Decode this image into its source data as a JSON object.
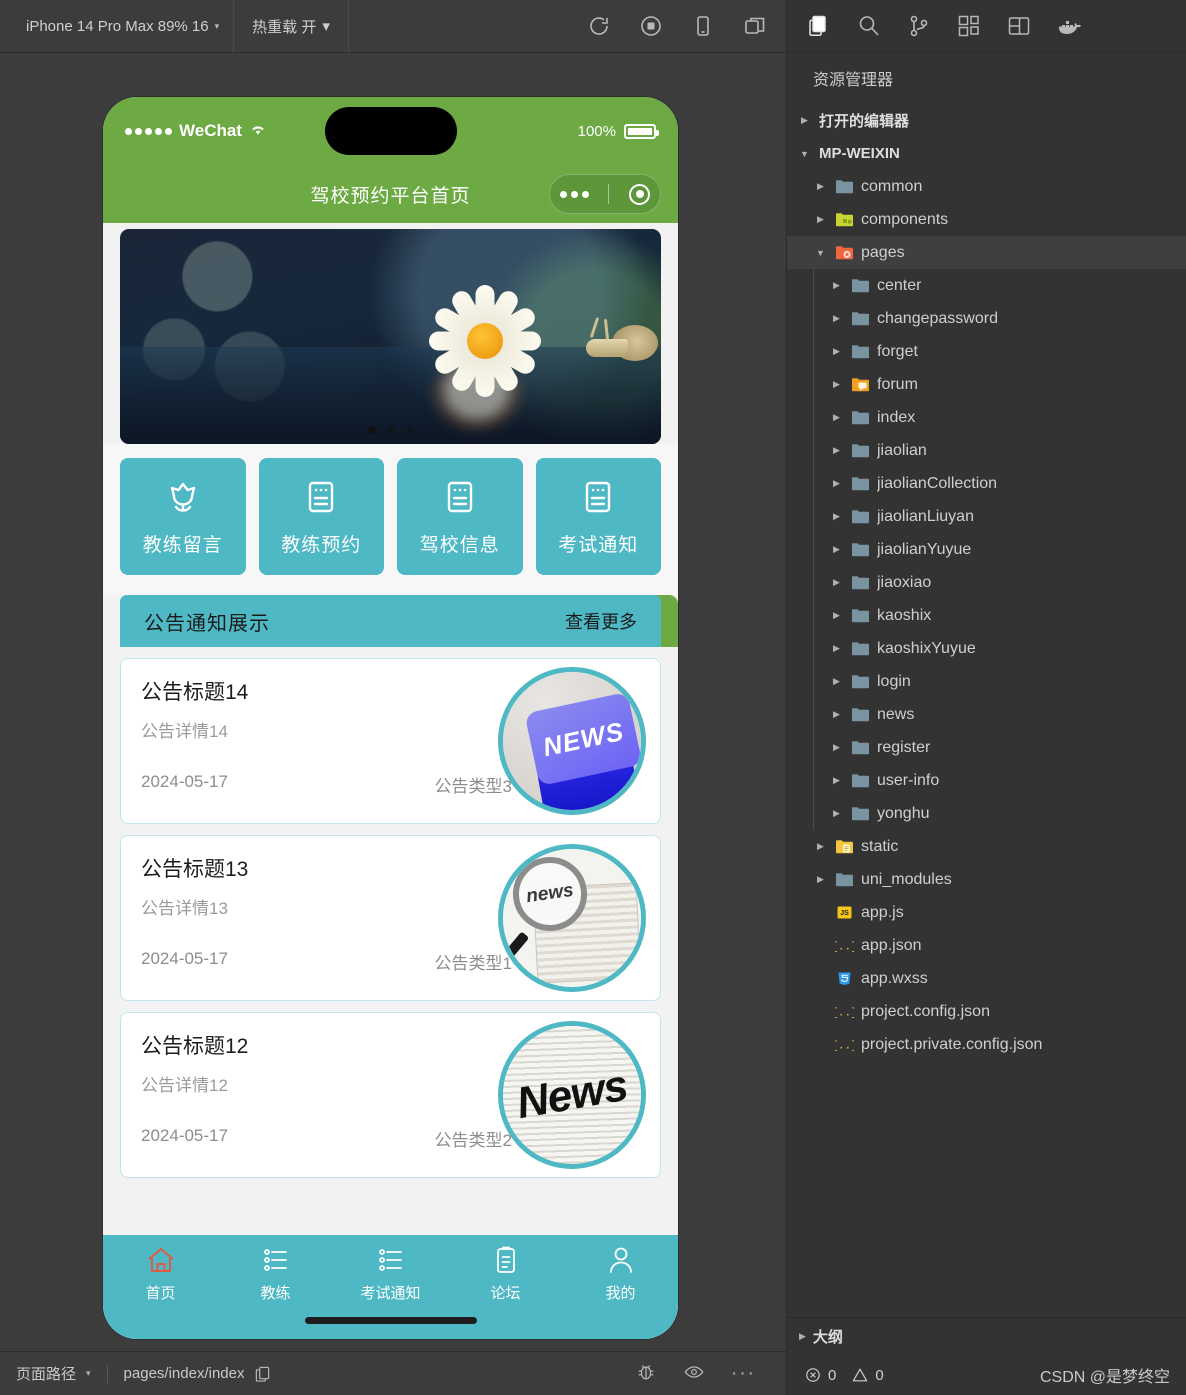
{
  "simulator": {
    "toolbar": {
      "device_label": "iPhone 14 Pro Max 89% 16",
      "hotreload_label": "热重载 开",
      "caret": "▾",
      "icons": [
        "refresh-icon",
        "stop-record-icon",
        "device-icon",
        "multi-window-icon"
      ]
    },
    "phone": {
      "status_bar": {
        "carrier": "WeChat",
        "battery_percent": "100%"
      },
      "nav_title": "驾校预约平台首页",
      "banner": {
        "dot_count": 3,
        "active_dot": 0
      },
      "categories": [
        {
          "label": "教练留言",
          "icon": "flower-icon"
        },
        {
          "label": "教练预约",
          "icon": "document-icon"
        },
        {
          "label": "驾校信息",
          "icon": "document-icon"
        },
        {
          "label": "考试通知",
          "icon": "document-icon"
        }
      ],
      "announce": {
        "title": "公告通知展示",
        "more": "查看更多"
      },
      "news": [
        {
          "title": "公告标题14",
          "desc": "公告详情14",
          "date": "2024-05-17",
          "type": "公告类型3",
          "thumb": "news-tag-thumb",
          "thumb_text": "NEWS"
        },
        {
          "title": "公告标题13",
          "desc": "公告详情13",
          "date": "2024-05-17",
          "type": "公告类型1",
          "thumb": "news-magnifier-thumb",
          "thumb_text": "news"
        },
        {
          "title": "公告标题12",
          "desc": "公告详情12",
          "date": "2024-05-17",
          "type": "公告类型2",
          "thumb": "news-paper-thumb",
          "thumb_text": "News"
        }
      ],
      "tabs": [
        {
          "label": "首页",
          "icon": "home-icon",
          "active": true
        },
        {
          "label": "教练",
          "icon": "list-icon",
          "active": false
        },
        {
          "label": "考试通知",
          "icon": "list-icon",
          "active": false
        },
        {
          "label": "论坛",
          "icon": "clipboard-icon",
          "active": false
        },
        {
          "label": "我的",
          "icon": "person-icon",
          "active": false
        }
      ]
    },
    "status_bar": {
      "path_label": "页面路径",
      "caret": "▾",
      "path_value": "pages/index/index",
      "icons": [
        "copy-icon",
        "bug-icon",
        "eye-icon",
        "more-icon"
      ]
    }
  },
  "explorer": {
    "activity_icons": [
      "files-icon",
      "search-icon",
      "source-control-icon",
      "extensions-icon",
      "layout-icon",
      "docker-icon"
    ],
    "title": "资源管理器",
    "tree": [
      {
        "label": "打开的编辑器",
        "type": "section",
        "indent": 0,
        "arrow": "right",
        "icon": "none"
      },
      {
        "label": "MP-WEIXIN",
        "type": "section",
        "indent": 0,
        "arrow": "down",
        "icon": "none"
      },
      {
        "label": "common",
        "type": "folder",
        "indent": 1,
        "arrow": "right",
        "icon": "folder-blue"
      },
      {
        "label": "components",
        "type": "folder",
        "indent": 1,
        "arrow": "right",
        "icon": "folder-green"
      },
      {
        "label": "pages",
        "type": "folder",
        "indent": 1,
        "arrow": "down",
        "icon": "folder-orange",
        "selected": true
      },
      {
        "label": "center",
        "type": "folder",
        "indent": 2,
        "arrow": "right",
        "icon": "folder-blue"
      },
      {
        "label": "changepassword",
        "type": "folder",
        "indent": 2,
        "arrow": "right",
        "icon": "folder-blue"
      },
      {
        "label": "forget",
        "type": "folder",
        "indent": 2,
        "arrow": "right",
        "icon": "folder-blue"
      },
      {
        "label": "forum",
        "type": "folder",
        "indent": 2,
        "arrow": "right",
        "icon": "folder-amber"
      },
      {
        "label": "index",
        "type": "folder",
        "indent": 2,
        "arrow": "right",
        "icon": "folder-blue"
      },
      {
        "label": "jiaolian",
        "type": "folder",
        "indent": 2,
        "arrow": "right",
        "icon": "folder-blue"
      },
      {
        "label": "jiaolianCollection",
        "type": "folder",
        "indent": 2,
        "arrow": "right",
        "icon": "folder-blue"
      },
      {
        "label": "jiaolianLiuyan",
        "type": "folder",
        "indent": 2,
        "arrow": "right",
        "icon": "folder-blue"
      },
      {
        "label": "jiaolianYuyue",
        "type": "folder",
        "indent": 2,
        "arrow": "right",
        "icon": "folder-blue"
      },
      {
        "label": "jiaoxiao",
        "type": "folder",
        "indent": 2,
        "arrow": "right",
        "icon": "folder-blue"
      },
      {
        "label": "kaoshix",
        "type": "folder",
        "indent": 2,
        "arrow": "right",
        "icon": "folder-blue"
      },
      {
        "label": "kaoshixYuyue",
        "type": "folder",
        "indent": 2,
        "arrow": "right",
        "icon": "folder-blue"
      },
      {
        "label": "login",
        "type": "folder",
        "indent": 2,
        "arrow": "right",
        "icon": "folder-blue"
      },
      {
        "label": "news",
        "type": "folder",
        "indent": 2,
        "arrow": "right",
        "icon": "folder-blue"
      },
      {
        "label": "register",
        "type": "folder",
        "indent": 2,
        "arrow": "right",
        "icon": "folder-blue"
      },
      {
        "label": "user-info",
        "type": "folder",
        "indent": 2,
        "arrow": "right",
        "icon": "folder-blue"
      },
      {
        "label": "yonghu",
        "type": "folder",
        "indent": 2,
        "arrow": "right",
        "icon": "folder-blue"
      },
      {
        "label": "static",
        "type": "folder",
        "indent": 1,
        "arrow": "right",
        "icon": "folder-yellow"
      },
      {
        "label": "uni_modules",
        "type": "folder",
        "indent": 1,
        "arrow": "right",
        "icon": "folder-blue"
      },
      {
        "label": "app.js",
        "type": "file",
        "indent": 1,
        "arrow": "none",
        "icon": "js-file"
      },
      {
        "label": "app.json",
        "type": "file",
        "indent": 1,
        "arrow": "none",
        "icon": "json-file"
      },
      {
        "label": "app.wxss",
        "type": "file",
        "indent": 1,
        "arrow": "none",
        "icon": "css-file"
      },
      {
        "label": "project.config.json",
        "type": "file",
        "indent": 1,
        "arrow": "none",
        "icon": "json-file"
      },
      {
        "label": "project.private.config.json",
        "type": "file",
        "indent": 1,
        "arrow": "none",
        "icon": "json-file"
      }
    ],
    "outline_label": "大纲",
    "footer": {
      "error_count": "0",
      "warning_count": "0",
      "watermark": "CSDN @是梦终空"
    }
  },
  "colors": {
    "wechat_green": "#6DAA44",
    "teal": "#4EB8C4",
    "editor_bg": "#333333",
    "toolbar_bg": "#3C3C3C",
    "active_tab_icon": "#E05A44"
  }
}
